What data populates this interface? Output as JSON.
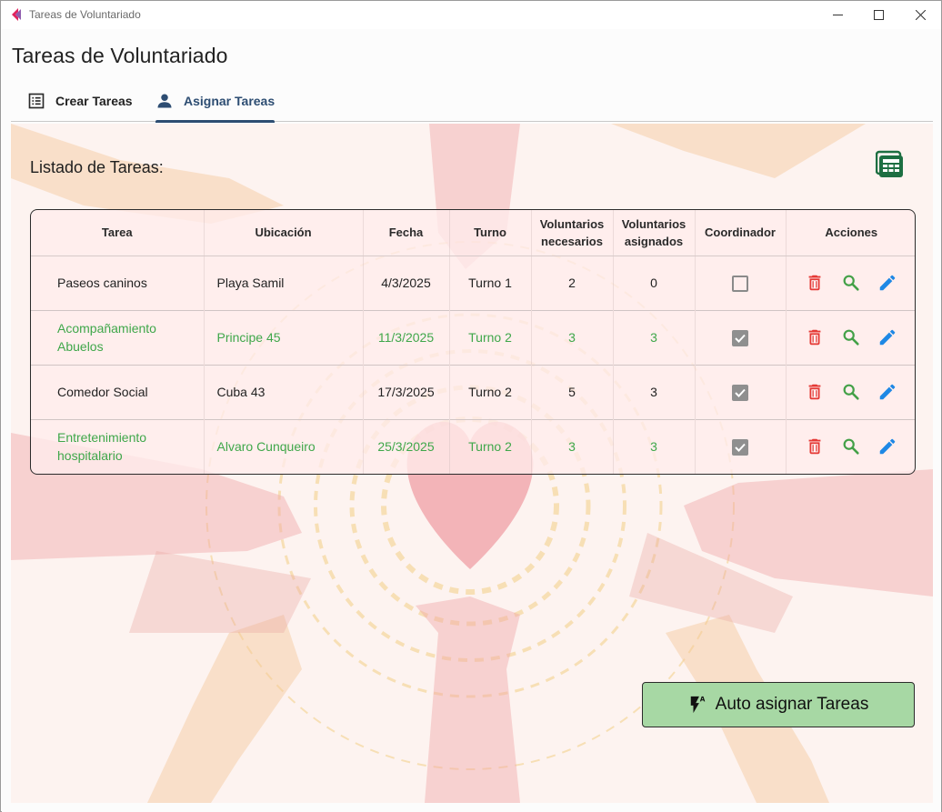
{
  "window": {
    "title": "Tareas de Voluntariado"
  },
  "page": {
    "title": "Tareas de Voluntariado"
  },
  "tabs": [
    {
      "label": "Crear Tareas",
      "icon": "list-icon",
      "active": false
    },
    {
      "label": "Asignar Tareas",
      "icon": "person-icon",
      "active": true
    }
  ],
  "list": {
    "title": "Listado de Tareas:",
    "export_icon": "spreadsheet-icon"
  },
  "table": {
    "headers": {
      "tarea": "Tarea",
      "ubicacion": "Ubicación",
      "fecha": "Fecha",
      "turno": "Turno",
      "necesarios_1": "Voluntarios",
      "necesarios_2": "necesarios",
      "asignados_1": "Voluntarios",
      "asignados_2": "asignados",
      "coordinador": "Coordinador",
      "acciones": "Acciones"
    },
    "rows": [
      {
        "tarea_1": "Paseos caninos",
        "tarea_2": "",
        "ubicacion": "Playa Samil",
        "fecha": "4/3/2025",
        "turno": "Turno 1",
        "necesarios": "2",
        "asignados": "0",
        "coordinador": false,
        "complete": false
      },
      {
        "tarea_1": "Acompañamiento",
        "tarea_2": "Abuelos",
        "ubicacion": "Principe 45",
        "fecha": "11/3/2025",
        "turno": "Turno 2",
        "necesarios": "3",
        "asignados": "3",
        "coordinador": true,
        "complete": true
      },
      {
        "tarea_1": "Comedor Social",
        "tarea_2": "",
        "ubicacion": "Cuba 43",
        "fecha": "17/3/2025",
        "turno": "Turno 2",
        "necesarios": "5",
        "asignados": "3",
        "coordinador": true,
        "complete": false
      },
      {
        "tarea_1": "Entretenimiento",
        "tarea_2": "hospitalario",
        "ubicacion": "Alvaro Cunqueiro",
        "fecha": "25/3/2025",
        "turno": "Turno 2",
        "necesarios": "3",
        "asignados": "3",
        "coordinador": true,
        "complete": true
      }
    ],
    "action_icons": [
      "delete-icon",
      "search-icon",
      "edit-icon"
    ]
  },
  "auto_button": {
    "label": "Auto asignar Tareas",
    "icon": "flash-auto-icon"
  },
  "colors": {
    "tab_active": "#2d4d72",
    "complete_text": "#3fa74a",
    "delete": "#e53935",
    "search": "#43a047",
    "edit": "#1e88e5",
    "auto_button_bg": "#a7d8a4",
    "excel": "#1d6f42"
  }
}
